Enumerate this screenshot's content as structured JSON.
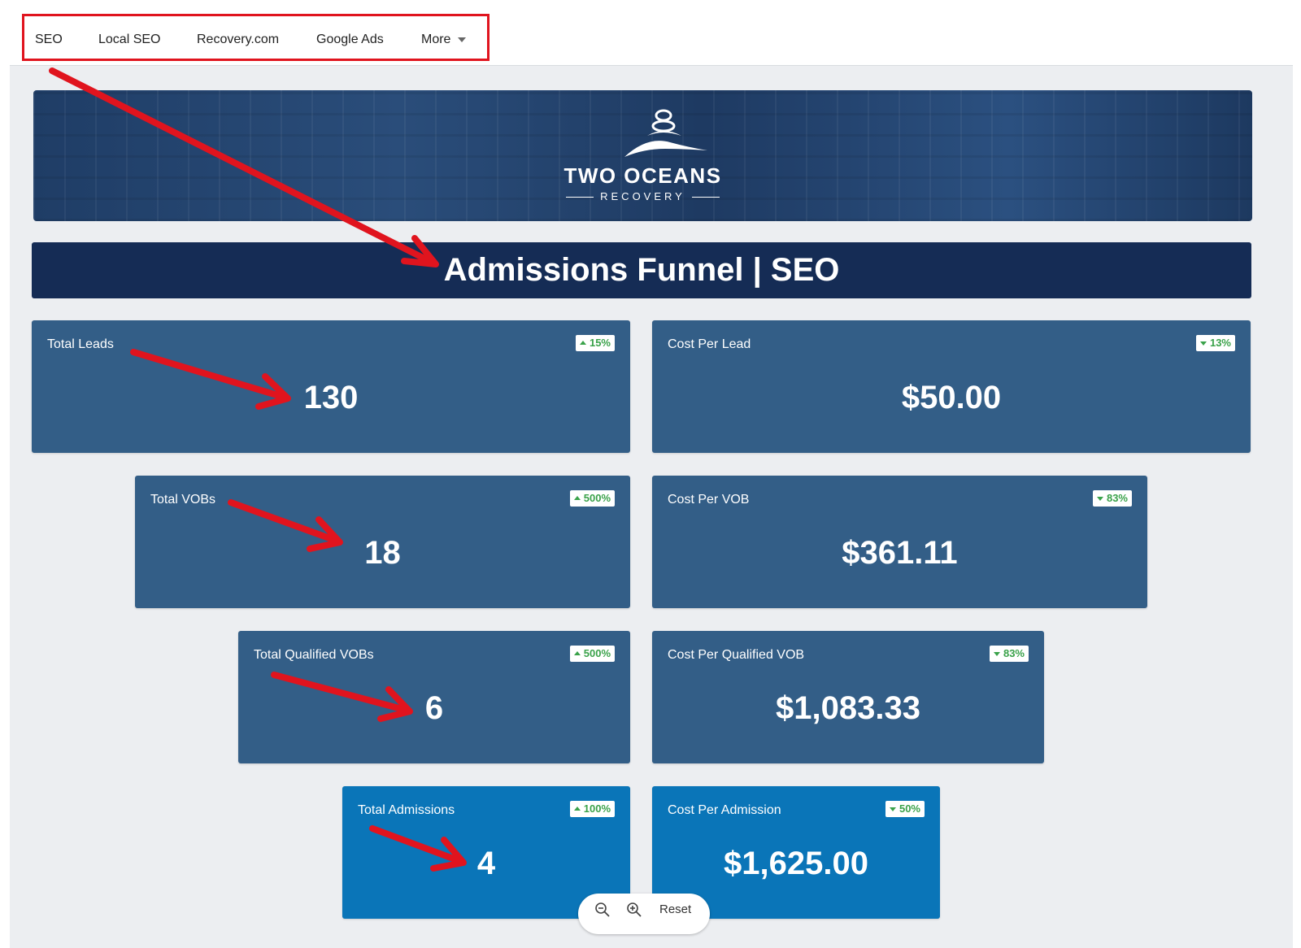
{
  "nav": {
    "items": [
      "SEO",
      "Local SEO",
      "Recovery.com",
      "Google Ads"
    ],
    "more_label": "More"
  },
  "banner": {
    "brand_name": "TWO OCEANS",
    "brand_sub": "RECOVERY"
  },
  "title": "Admissions Funnel | SEO",
  "metrics": {
    "total_leads": {
      "label": "Total Leads",
      "value": "130",
      "change": "15%",
      "direction": "up"
    },
    "cost_per_lead": {
      "label": "Cost Per Lead",
      "value": "$50.00",
      "change": "13%",
      "direction": "down"
    },
    "total_vobs": {
      "label": "Total VOBs",
      "value": "18",
      "change": "500%",
      "direction": "up"
    },
    "cost_per_vob": {
      "label": "Cost Per VOB",
      "value": "$361.11",
      "change": "83%",
      "direction": "down"
    },
    "total_qualified_vobs": {
      "label": "Total Qualified VOBs",
      "value": "6",
      "change": "500%",
      "direction": "up"
    },
    "cost_per_qualified_vob": {
      "label": "Cost Per Qualified VOB",
      "value": "$1,083.33",
      "change": "83%",
      "direction": "down"
    },
    "total_admissions": {
      "label": "Total Admissions",
      "value": "4",
      "change": "100%",
      "direction": "up"
    },
    "cost_per_admission": {
      "label": "Cost Per Admission",
      "value": "$1,625.00",
      "change": "50%",
      "direction": "down"
    }
  },
  "zoom": {
    "reset_label": "Reset"
  },
  "colors": {
    "title_bar": "#152c55",
    "card": "#335e87",
    "card_bright": "#0a75b8",
    "badge_text": "#3aa24a",
    "annotation": "#e0141e"
  }
}
